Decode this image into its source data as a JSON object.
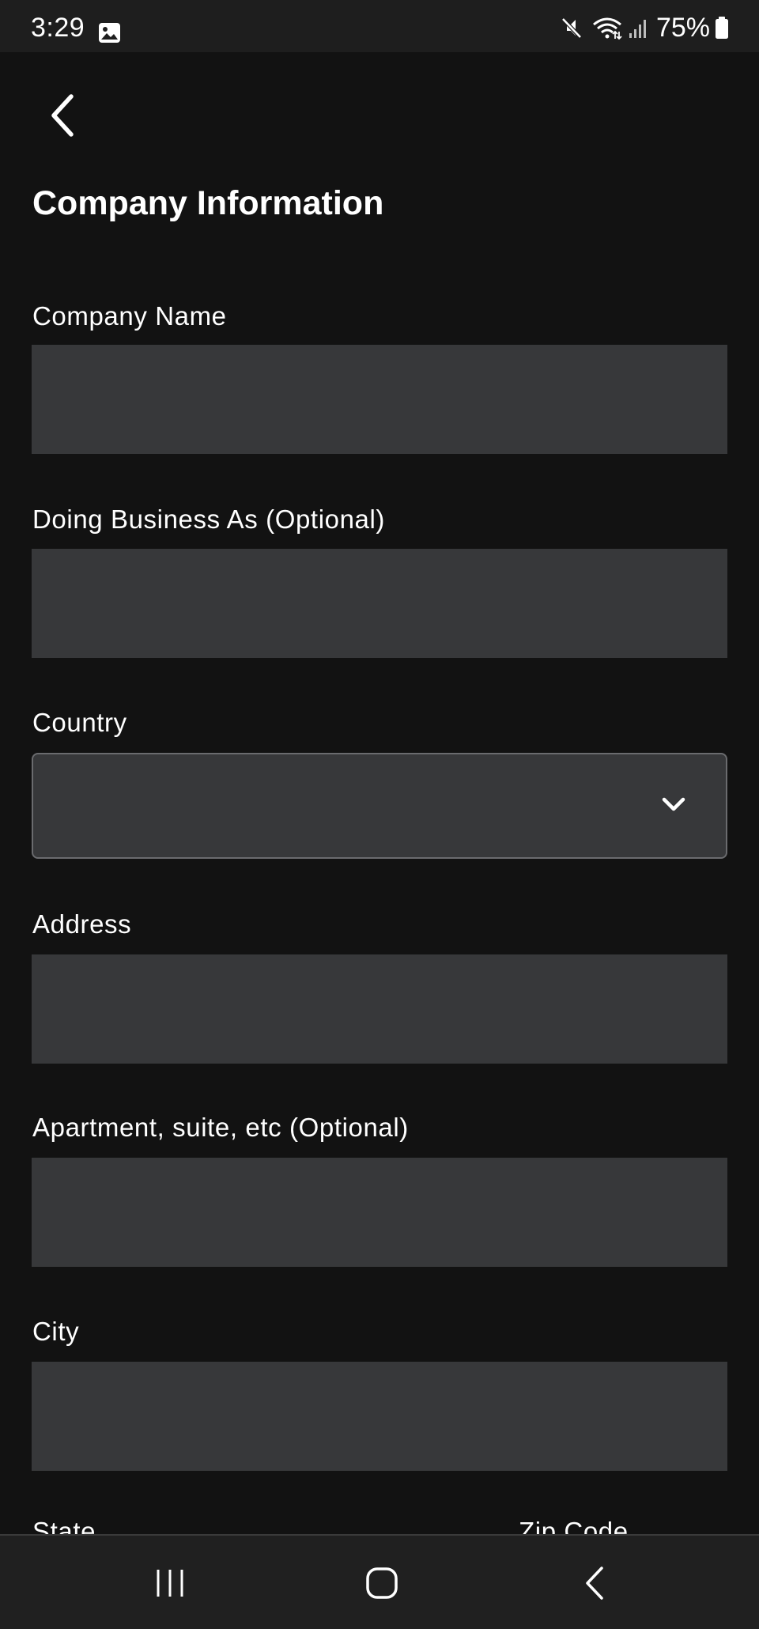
{
  "status_bar": {
    "time": "3:29",
    "battery_percent": "75%",
    "icons": [
      "gallery-icon",
      "mute-icon",
      "wifi-icon",
      "signal-icon",
      "battery-icon"
    ]
  },
  "header": {
    "back_icon": "chevron-left-icon",
    "title": "Company Information"
  },
  "form": {
    "company_name": {
      "label": "Company Name",
      "value": ""
    },
    "dba": {
      "label": "Doing Business As (Optional)",
      "value": ""
    },
    "country": {
      "label": "Country",
      "value": ""
    },
    "address": {
      "label": "Address",
      "value": ""
    },
    "apartment": {
      "label": "Apartment, suite, etc (Optional)",
      "value": ""
    },
    "city": {
      "label": "City",
      "value": ""
    },
    "state": {
      "label": "State"
    },
    "zip": {
      "label": "Zip Code"
    }
  },
  "nav_bar": {
    "icons": [
      "recent-apps-icon",
      "home-icon",
      "back-icon"
    ]
  },
  "colors": {
    "background": "#121212",
    "input_background": "#37383a",
    "select_border": "#6a6b6e",
    "text": "#ffffff"
  }
}
